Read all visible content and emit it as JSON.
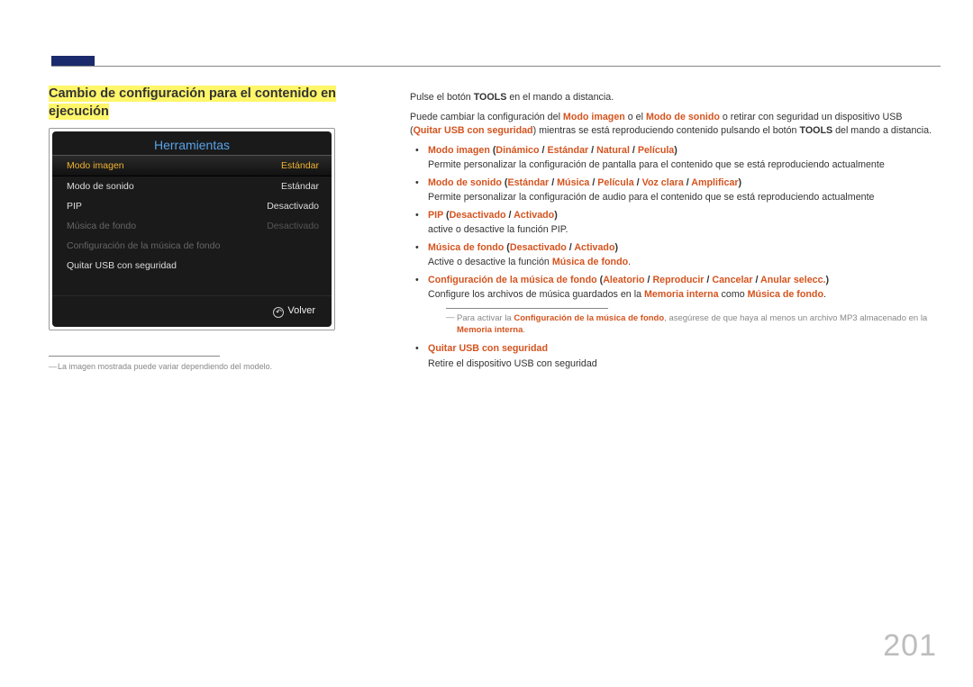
{
  "page_number": "201",
  "section_title_line1": "Cambio de configuración para el contenido en",
  "section_title_line2": "ejecución",
  "tv": {
    "title": "Herramientas",
    "rows": [
      {
        "label": "Modo imagen",
        "value": "Estándar",
        "state": "selected"
      },
      {
        "label": "Modo de sonido",
        "value": "Estándar",
        "state": "normal"
      },
      {
        "label": "PIP",
        "value": "Desactivado",
        "state": "normal"
      },
      {
        "label": "Música de fondo",
        "value": "Desactivado",
        "state": "dim"
      },
      {
        "label": "Configuración de la música de fondo",
        "value": "",
        "state": "dim"
      },
      {
        "label": "Quitar USB con seguridad",
        "value": "",
        "state": "normal"
      }
    ],
    "footer": "Volver"
  },
  "footnote": "La imagen mostrada puede variar dependiendo del modelo.",
  "intro": {
    "line1_pre": "Pulse el botón ",
    "line1_b": "TOOLS",
    "line1_post": " en el mando a distancia.",
    "line2_a": "Puede cambiar la configuración del ",
    "line2_b": "Modo imagen",
    "line2_c": " o el ",
    "line2_d": "Modo de sonido",
    "line2_e": " o retirar con seguridad un dispositivo USB (",
    "line2_f": "Quitar USB con seguridad",
    "line2_g": ") mientras se está reproduciendo contenido pulsando el botón ",
    "line2_h": "TOOLS",
    "line2_i": " del mando a distancia."
  },
  "bullets": [
    {
      "lead": "Modo imagen",
      "opts": [
        "Dinámico",
        "Estándar",
        "Natural",
        "Película"
      ],
      "desc": "Permite personalizar la configuración de pantalla para el contenido que se está reproduciendo actualmente"
    },
    {
      "lead": "Modo de sonido",
      "opts": [
        "Estándar",
        "Música",
        "Película",
        "Voz clara",
        "Amplificar"
      ],
      "desc": "Permite personalizar la configuración de audio para el contenido que se está reproduciendo actualmente"
    },
    {
      "lead": "PIP",
      "opts": [
        "Desactivado",
        "Activado"
      ],
      "desc": "active o desactive la función PIP."
    },
    {
      "lead": "Música de fondo",
      "opts": [
        "Desactivado",
        "Activado"
      ],
      "desc_pre": "Active o desactive la función ",
      "desc_bold": "Música de fondo",
      "desc_post": "."
    },
    {
      "lead": "Configuración de la música de fondo",
      "opts": [
        "Aleatorio",
        "Reproducir",
        "Cancelar",
        "Anular selecc."
      ],
      "desc_a": "Configure los archivos de música guardados en la ",
      "desc_b": "Memoria interna",
      "desc_c": " como ",
      "desc_d": "Música de fondo",
      "desc_e": "."
    },
    {
      "lead": "Quitar USB con seguridad",
      "desc": "Retire el dispositivo USB con seguridad"
    }
  ],
  "note": {
    "a": "Para activar la ",
    "b": "Configuración de la música de fondo",
    "c": ", asegúrese de que haya al menos un archivo MP3 almacenado en la ",
    "d": "Memoria interna",
    "e": "."
  }
}
